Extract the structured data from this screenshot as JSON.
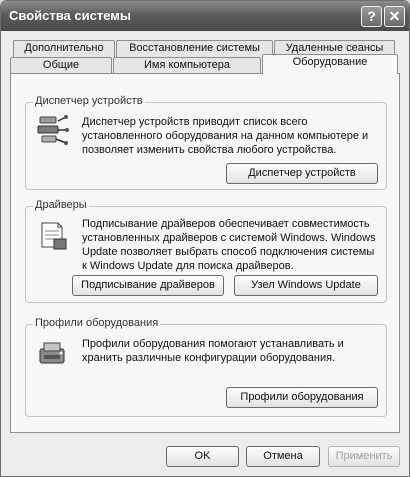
{
  "window": {
    "title": "Свойства системы",
    "help_label": "?",
    "close_label": "✕"
  },
  "tabs": {
    "row1": [
      "Дополнительно",
      "Восстановление системы",
      "Удаленные сеансы"
    ],
    "row2": [
      "Общие",
      "Имя компьютера",
      "Оборудование"
    ],
    "active": "Оборудование"
  },
  "device_manager": {
    "title": "Диспетчер устройств",
    "description": "Диспетчер устройств приводит список всего установленного оборудования на данном компьютере и позволяет изменить свойства любого устройства.",
    "button": "Диспетчер устройств",
    "icon": "device-manager-icon"
  },
  "drivers": {
    "title": "Драйверы",
    "description": "Подписывание драйверов обеспечивает совместимость установленных драйверов с системой Windows.  Windows Update позволяет выбрать способ подключения системы к Windows Update для поиска драйверов.",
    "signing_button": "Подписывание драйверов",
    "update_button": "Узел Windows Update",
    "icon": "drivers-icon"
  },
  "hardware_profiles": {
    "title": "Профили оборудования",
    "description": "Профили оборудования помогают устанавливать и хранить различные конфигурации оборудования.",
    "button": "Профили оборудования",
    "icon": "hardware-profiles-icon"
  },
  "dialog_buttons": {
    "ok": "OK",
    "cancel": "Отмена",
    "apply": "Применить"
  }
}
